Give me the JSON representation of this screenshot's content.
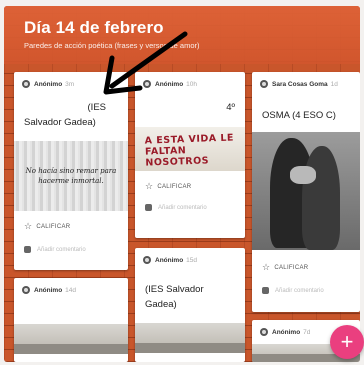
{
  "board": {
    "title": "Día 14 de febrero",
    "subtitle": "Paredes de acción poética (frases y versos de amor)"
  },
  "posts": [
    {
      "author": "Anónimo",
      "time": "3m",
      "title_line1": "(IES",
      "title_line2": "Salvador Gadea)",
      "image_text_line1": "No hacía sino remar para",
      "image_text_line2": "hacerme inmortal.",
      "rate_label": "CALIFICAR",
      "comment_placeholder": "Añadir comentario"
    },
    {
      "author": "Anónimo",
      "time": "10h",
      "title": "4º",
      "image_text_line1": "A ESTA VIDA LE",
      "image_text_line2": "FALTAN NOSOTROS",
      "rate_label": "CALIFICAR",
      "comment_placeholder": "Añadir comentario"
    },
    {
      "author": "Sara Cosas Goma",
      "time": "1d",
      "title": "OSMA (4 ESO C)",
      "rate_label": "CALIFICAR",
      "comment_placeholder": "Añadir comentario"
    },
    {
      "author": "Anónimo",
      "time": "15d",
      "title_line1": "(IES Salvador",
      "title_line2": "Gadea)"
    },
    {
      "author": "Anónimo",
      "time": "14d"
    },
    {
      "author": "Anónimo",
      "time": "7d"
    }
  ],
  "fab_label": "+",
  "icons": {
    "avatar": "avatar-icon",
    "star": "star-icon",
    "comment": "comment-icon",
    "add": "plus-icon"
  },
  "colors": {
    "board_accent": "#c9562b",
    "fab": "#ea3f7f"
  }
}
